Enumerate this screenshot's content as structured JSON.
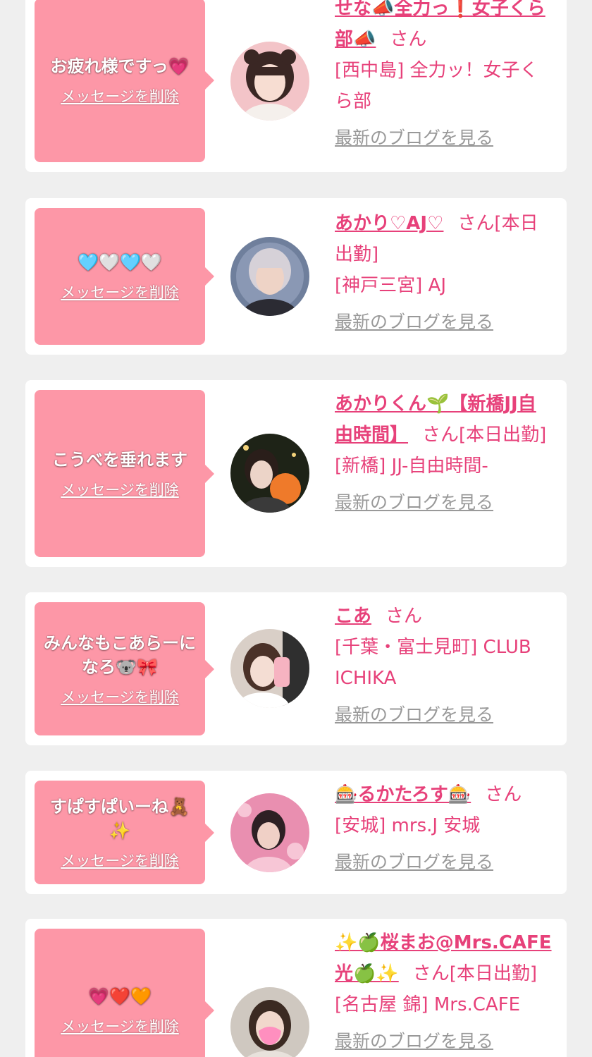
{
  "messages": [
    {
      "bubble_text": "お疲れ様ですっ💗",
      "delete_label": "メッセージを削除",
      "name": "せな📣全力っ❗女子くら部📣",
      "suffix": "さん",
      "shop": "[西中島] 全力ッ！女子くら部",
      "blog_link": "最新のブログを見る",
      "avatar": {
        "bg": "#f3c4c8",
        "hair": "#3a2724",
        "skin": "#f7ddd2",
        "cloth": "#f5f0ec"
      }
    },
    {
      "bubble_text": "🩵🤍🩵🤍",
      "delete_label": "メッセージを削除",
      "name": "あかり♡AJ♡",
      "suffix": "さん[本日出勤]",
      "shop": "[神戸三宮] AJ",
      "blog_link": "最新のブログを見る",
      "avatar": {
        "bg": "#6f7f9c",
        "hair": "#d6d1d8",
        "skin": "#eed3c6",
        "cloth": "#2b2b33"
      }
    },
    {
      "bubble_text": "こうべを垂れます",
      "delete_label": "メッセージを削除",
      "name": "あかりくん🌱【新橋JJ自由時間】",
      "suffix": "さん[本日出勤]",
      "shop": "[新橋] JJ-自由時間-",
      "blog_link": "最新のブログを見る",
      "avatar": {
        "bg": "#1e2317",
        "hair": "#2a1e1a",
        "skin": "#ecd4c8",
        "cloth": "#ef7a2a"
      }
    },
    {
      "bubble_text": "みんなもこあらーになろ🐨🎀",
      "delete_label": "メッセージを削除",
      "name": "こあ",
      "suffix": "さん",
      "shop": "[千葉・富士見町] CLUB ICHIKA",
      "blog_link": "最新のブログを見る",
      "avatar": {
        "bg": "#d9cfc7",
        "hair": "#4a3128",
        "skin": "#f4ddd3",
        "cloth": "#f6b3c1"
      }
    },
    {
      "bubble_text": "すぱすぱいーね🧸✨",
      "delete_label": "メッセージを削除",
      "name": "🎰るかたろす🎰",
      "suffix": "さん",
      "shop": "[安城] mrs.J 安城",
      "blog_link": "最新のブログを見る",
      "avatar": {
        "bg": "#e98fb0",
        "hair": "#2d2024",
        "skin": "#f0d0c6",
        "cloth": "#f7c6d6"
      }
    },
    {
      "bubble_text": "💗❤️🧡",
      "delete_label": "メッセージを削除",
      "name": "✨🍏桜まお@Mrs.CAFE光🍏✨",
      "suffix": "さん[本日出勤]",
      "shop": "[名古屋 錦] Mrs.CAFE",
      "blog_link": "最新のブログを見る",
      "avatar": {
        "bg": "#cfc8c0",
        "hair": "#3b2a22",
        "skin": "#f1d8cc",
        "cloth": "#ff8fbf"
      }
    }
  ]
}
